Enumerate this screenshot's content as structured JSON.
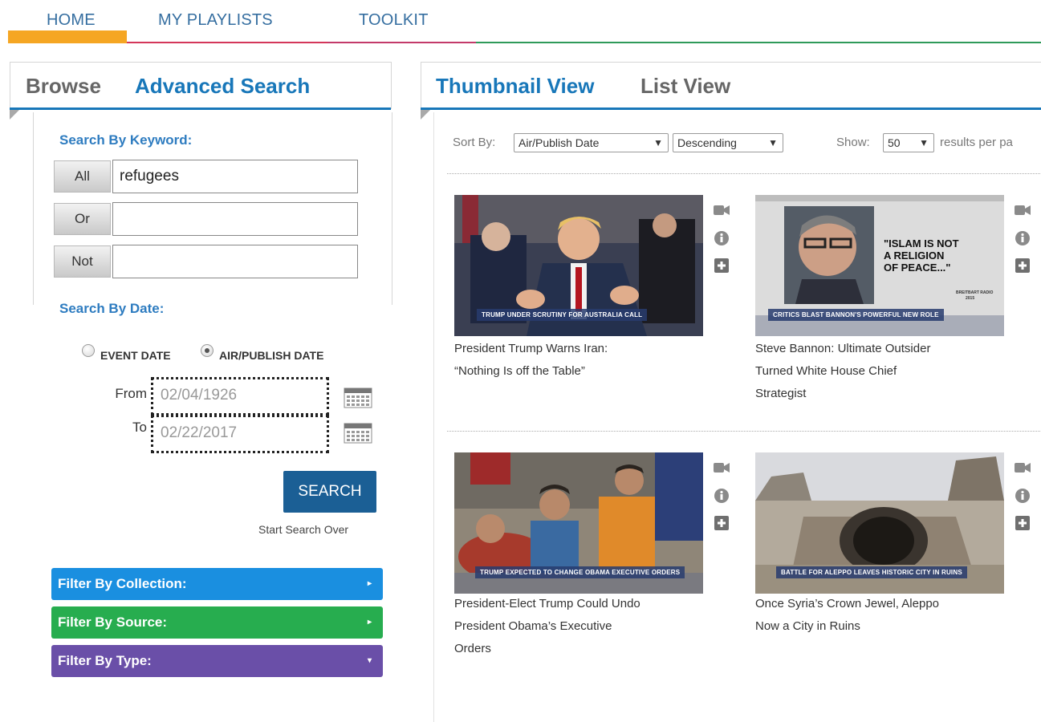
{
  "nav": {
    "items": [
      "HOME",
      "MY PLAYLISTS",
      "TOOLKIT"
    ],
    "colors": {
      "home": "#f5a623",
      "playlists": "#d4365a",
      "toolkit": "#2f9a5a",
      "text": "#356ea0"
    }
  },
  "left_tabs": {
    "browse": "Browse",
    "advanced": "Advanced Search"
  },
  "keyword": {
    "label": "Search By Keyword:",
    "rows": [
      {
        "button": "All",
        "value": "refugees"
      },
      {
        "button": "Or",
        "value": ""
      },
      {
        "button": "Not",
        "value": ""
      }
    ]
  },
  "date": {
    "label": "Search By Date:",
    "options": [
      "EVENT DATE",
      "AIR/PUBLISH DATE"
    ],
    "selected": "AIR/PUBLISH DATE",
    "from_label": "From",
    "from_value": "02/04/1926",
    "to_label": "To",
    "to_value": "02/22/2017"
  },
  "search_button": "SEARCH",
  "start_over": "Start Search Over",
  "filters": [
    {
      "label": "Filter By Collection:",
      "color": "#1a8fe0",
      "arrow": "▸"
    },
    {
      "label": "Filter By Source:",
      "color": "#27ad4f",
      "arrow": "▸"
    },
    {
      "label": "Filter By Type:",
      "color": "#6a4fa8",
      "arrow": "▾"
    }
  ],
  "right_tabs": {
    "thumbnail": "Thumbnail View",
    "list": "List View"
  },
  "sort": {
    "label": "Sort By:",
    "field": "Air/Publish Date",
    "order": "Descending",
    "show_label": "Show:",
    "per_page": "50",
    "per_page_suffix": "results per pa"
  },
  "results": [
    {
      "title_line1": "President Trump Warns Iran:",
      "title_line2": "“Nothing Is off the Table”",
      "title_line3": "",
      "caption": "TRUMP UNDER SCRUTINY FOR AUSTRALIA CALL"
    },
    {
      "title_line1": "Steve Bannon: Ultimate Outsider",
      "title_line2": "Turned White House Chief",
      "title_line3": "Strategist",
      "caption": "CRITICS BLAST BANNON'S POWERFUL NEW ROLE",
      "quote": [
        "\"ISLAM IS NOT",
        "A RELIGION",
        "OF PEACE...\""
      ],
      "quote_source": [
        "BREITBART RADIO",
        "2015"
      ]
    },
    {
      "title_line1": "President-Elect Trump Could Undo",
      "title_line2": "President Obama’s Executive",
      "title_line3": "Orders",
      "caption": "TRUMP EXPECTED TO CHANGE OBAMA EXECUTIVE ORDERS"
    },
    {
      "title_line1": "Once Syria’s Crown Jewel, Aleppo",
      "title_line2": "Now a City in Ruins",
      "title_line3": "",
      "caption": "BATTLE FOR ALEPPO LEAVES HISTORIC CITY IN RUINS"
    }
  ],
  "icons": [
    "video-camera-icon",
    "info-icon",
    "plus-icon",
    "calendar-icon"
  ]
}
